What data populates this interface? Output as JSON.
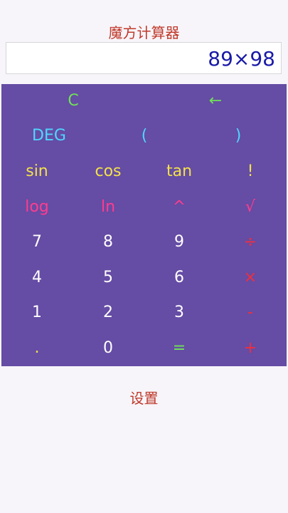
{
  "app": {
    "title": "魔方计算器"
  },
  "display": {
    "value": "89×98"
  },
  "keys": {
    "clear": "C",
    "backspace": "←",
    "deg": "DEG",
    "lparen": "(",
    "rparen": ")",
    "sin": "sin",
    "cos": "cos",
    "tan": "tan",
    "factorial": "!",
    "log": "log",
    "ln": "ln",
    "power": "^",
    "sqrt": "√",
    "n7": "7",
    "n8": "8",
    "n9": "9",
    "divide": "÷",
    "n4": "4",
    "n5": "5",
    "n6": "6",
    "multiply": "×",
    "n1": "1",
    "n2": "2",
    "n3": "3",
    "minus": "-",
    "dot": ".",
    "n0": "0",
    "equals": "=",
    "plus": "+"
  },
  "footer": {
    "settings_label": "设置"
  },
  "colors": {
    "keypad_bg": "#654ca4",
    "title": "#c0392b",
    "display_text": "#1a1aa8",
    "green": "#6fe05a",
    "cyan": "#4fd6ff",
    "yellow": "#f2e14b",
    "pink": "#ff3c8e",
    "red": "#f02f3e"
  }
}
